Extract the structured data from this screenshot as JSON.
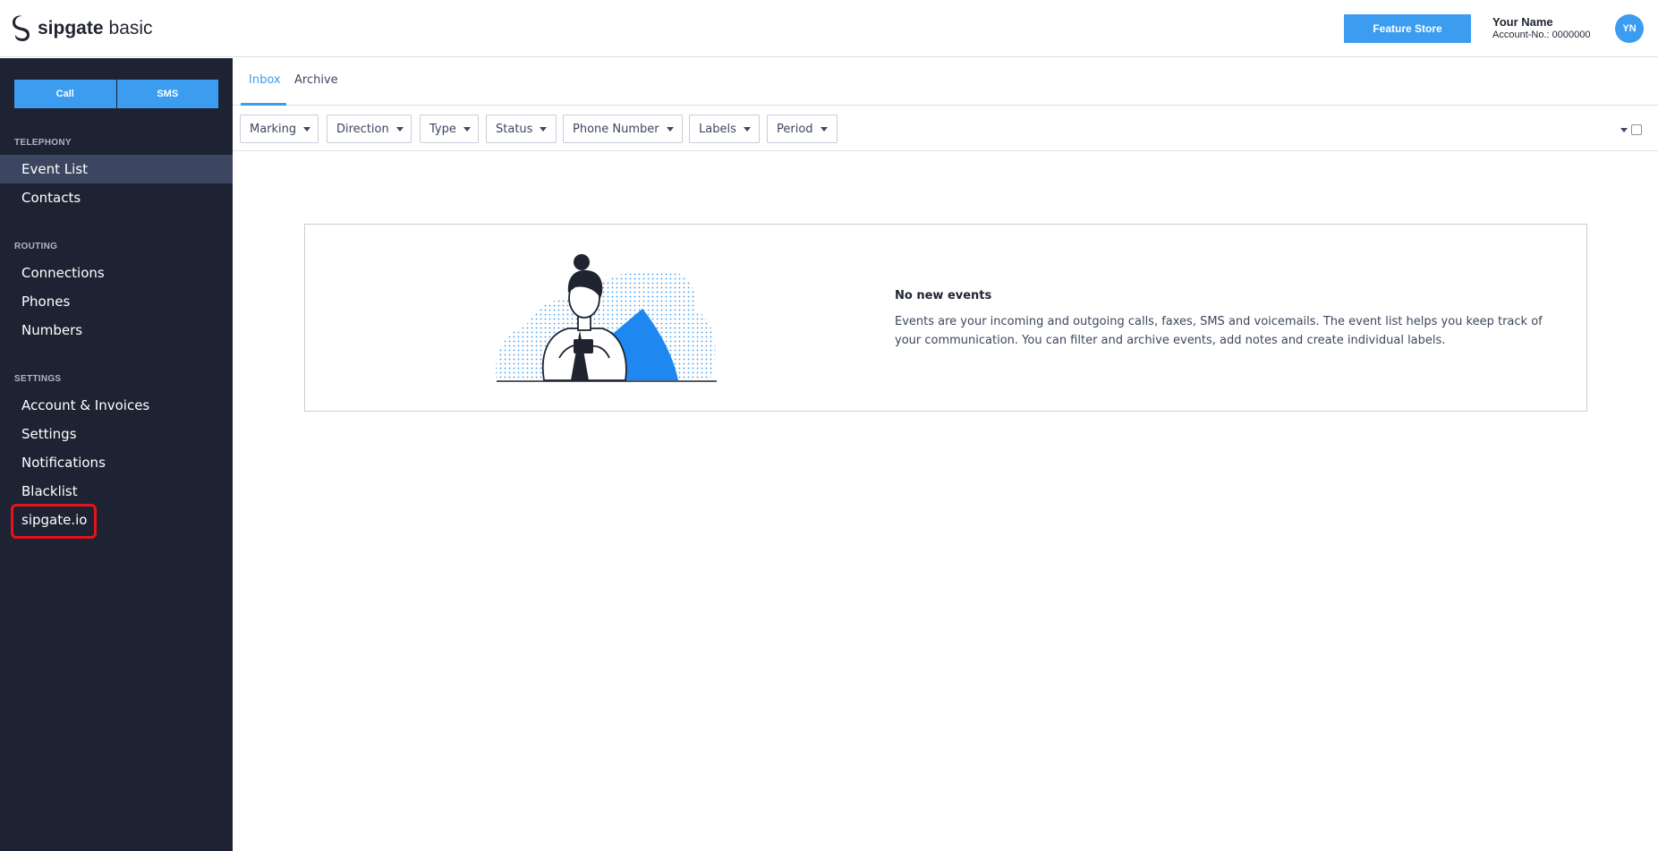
{
  "header": {
    "logo_bold": "sipgate",
    "logo_light": "basic",
    "feature_store_label": "Feature Store",
    "user_name": "Your Name",
    "account_number": "Account-No.: 0000000",
    "avatar_initials": "YN"
  },
  "sidebar": {
    "call_label": "Call",
    "sms_label": "SMS",
    "sections": {
      "telephony": "TELEPHONY",
      "routing": "ROUTING",
      "settings": "SETTINGS"
    },
    "items": {
      "event_list": "Event List",
      "contacts": "Contacts",
      "connections": "Connections",
      "phones": "Phones",
      "numbers": "Numbers",
      "account_invoices": "Account & Invoices",
      "settings": "Settings",
      "notifications": "Notifications",
      "blacklist": "Blacklist",
      "sipgate_io": "sipgate.io"
    },
    "active_item": "Event List",
    "highlighted_item": "sipgate.io"
  },
  "tabs": {
    "inbox": "Inbox",
    "archive": "Archive",
    "active": "Inbox"
  },
  "filters": {
    "marking": "Marking",
    "direction": "Direction",
    "type": "Type",
    "status": "Status",
    "phone_number": "Phone Number",
    "labels": "Labels",
    "period": "Period"
  },
  "empty_state": {
    "title": "No new events",
    "description": "Events are your incoming and outgoing calls, faxes, SMS and voicemails. The event list helps you keep track of your communication. You can filter and archive events, add notes and create individual labels."
  },
  "colors": {
    "accent": "#3b9cf0",
    "sidebar_bg": "#1d2333",
    "sidebar_active": "#3c4660",
    "highlight": "#e3131b"
  }
}
